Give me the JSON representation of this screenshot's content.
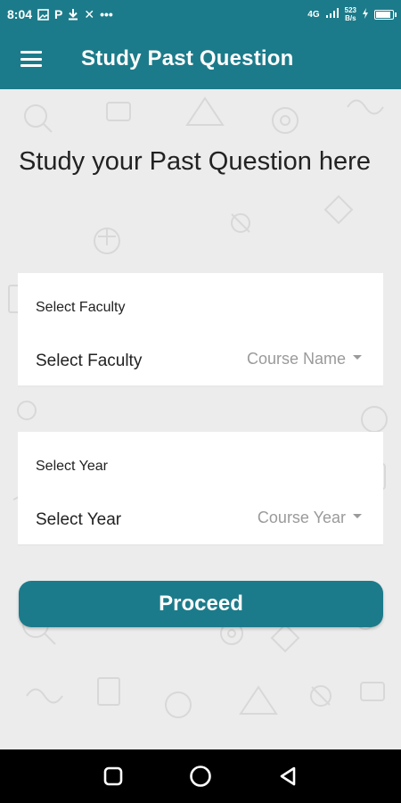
{
  "status_bar": {
    "time": "8:04",
    "icons": [
      "photo-icon",
      "p-icon",
      "download-icon",
      "x-icon",
      "more-dots-icon"
    ],
    "network": "4G",
    "speed_value": "523",
    "speed_unit": "B/s"
  },
  "app_bar": {
    "title": "Study Past Question"
  },
  "main": {
    "heading": "Study your Past Question here",
    "faculty_card": {
      "small_label": "Select Faculty",
      "label": "Select Faculty",
      "dropdown_value": "Course Name"
    },
    "year_card": {
      "small_label": "Select Year",
      "label": "Select Year",
      "dropdown_value": "Course Year"
    },
    "proceed_label": "Proceed"
  },
  "colors": {
    "primary": "#1c7b8a",
    "background": "#ececec",
    "card": "#ffffff",
    "placeholder_text": "#9a9a9a"
  },
  "nav_bar": {
    "icons": [
      "recents-square-icon",
      "home-circle-icon",
      "back-triangle-icon"
    ]
  }
}
